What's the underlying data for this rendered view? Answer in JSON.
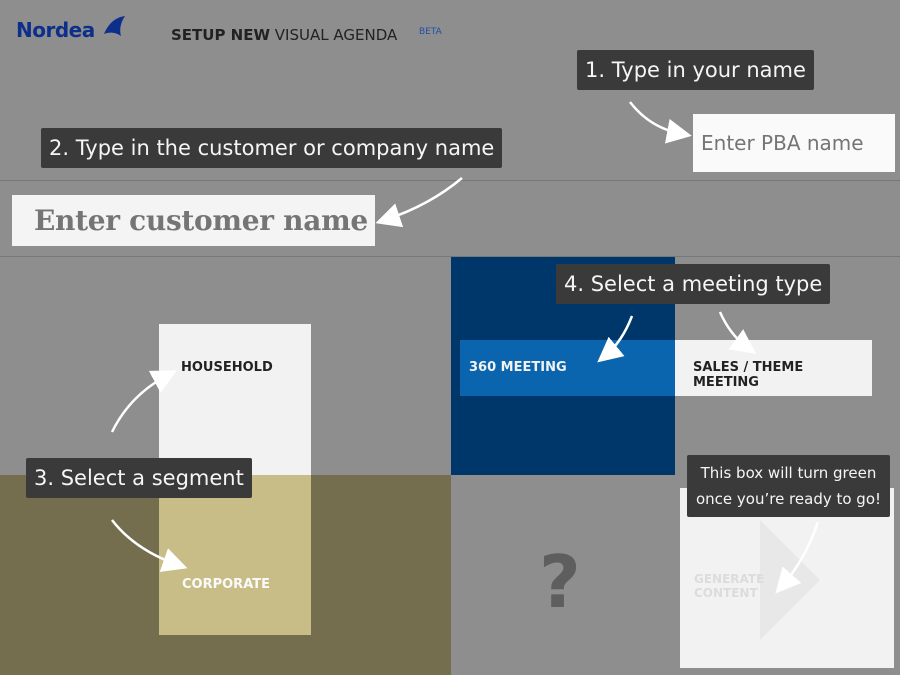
{
  "header": {
    "logo_text": "Nordea",
    "title_bold": "SETUP NEW",
    "title_rest": " VISUAL AGENDA",
    "beta": "BETA"
  },
  "steps": {
    "step1": "1. Type in your name",
    "step2": "2. Type in the customer or company name",
    "step3": "3. Select a segment",
    "step4": "4. Select a meeting type"
  },
  "pba": {
    "placeholder": "Enter PBA name"
  },
  "customer": {
    "placeholder": "Enter customer name"
  },
  "segments": {
    "household": "HOUSEHOLD",
    "corporate": "CORPORATE"
  },
  "meeting_types": {
    "m360": "360 MEETING",
    "sales": "SALES / THEME MEETING"
  },
  "generate": {
    "label_line1": "GENERATE",
    "label_line2": "CONTENT",
    "tip_line1": "This box will turn green",
    "tip_line2": "once you’re ready to go!"
  },
  "placeholder_symbol": "?",
  "colors": {
    "brand": "#0d2f8c",
    "corporate": "#c9bd87",
    "meeting_dark": "#00376b",
    "meeting_selected": "#0a65ae"
  }
}
